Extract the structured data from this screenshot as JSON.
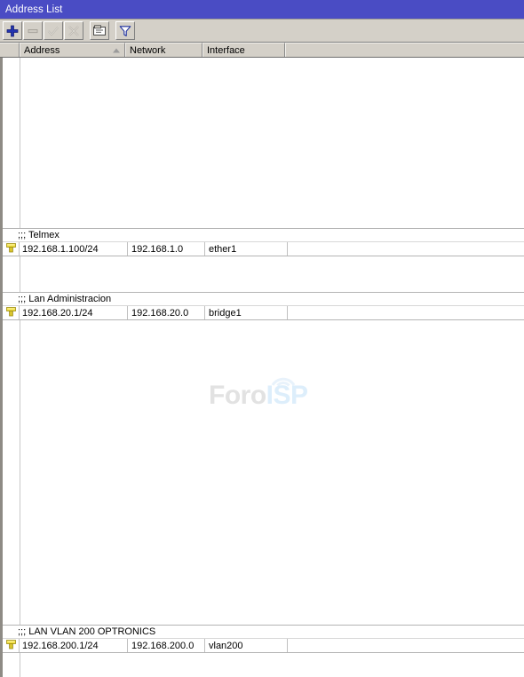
{
  "window": {
    "title": "Address List"
  },
  "toolbar": {
    "buttons": [
      {
        "name": "add-button",
        "icon": "plus-icon",
        "tooltip": "Add",
        "enabled": true
      },
      {
        "name": "remove-button",
        "icon": "minus-icon",
        "tooltip": "Remove",
        "enabled": false
      },
      {
        "name": "enable-button",
        "icon": "check-icon",
        "tooltip": "Enable",
        "enabled": false
      },
      {
        "name": "disable-button",
        "icon": "cross-icon",
        "tooltip": "Disable",
        "enabled": false
      },
      {
        "name": "comment-button",
        "icon": "comment-icon",
        "tooltip": "Comment",
        "enabled": true
      },
      {
        "name": "filter-button",
        "icon": "filter-icon",
        "tooltip": "Filter",
        "enabled": true
      }
    ]
  },
  "table": {
    "columns": [
      {
        "key": "flag",
        "label": ""
      },
      {
        "key": "address",
        "label": "Address",
        "sorted": "ascending"
      },
      {
        "key": "network",
        "label": "Network"
      },
      {
        "key": "interface",
        "label": "Interface"
      },
      {
        "key": "extra",
        "label": ""
      }
    ],
    "groups": [
      {
        "comment": ";;; Telmex",
        "rows": [
          {
            "flag": "pin-icon",
            "address": "192.168.1.100/24",
            "network": "192.168.1.0",
            "interface": "ether1",
            "extra": ""
          }
        ]
      },
      {
        "comment": ";;; Lan Administracion",
        "rows": [
          {
            "flag": "pin-icon",
            "address": "192.168.20.1/24",
            "network": "192.168.20.0",
            "interface": "bridge1",
            "extra": ""
          }
        ]
      },
      {
        "comment": ";;; LAN VLAN 200 OPTRONICS",
        "rows": [
          {
            "flag": "pin-icon",
            "address": "192.168.200.1/24",
            "network": "192.168.200.0",
            "interface": "vlan200",
            "extra": ""
          }
        ]
      }
    ]
  },
  "watermark": {
    "part1": "Foro",
    "part2": "ISP"
  },
  "colors": {
    "titlebar": "#4a4cc4",
    "toolbar": "#d4d0c8",
    "accent_add": "#2333b0",
    "row_icon": "#e8d22a",
    "watermark_gray": "#e2e2e2",
    "watermark_blue": "#ddeefb"
  }
}
